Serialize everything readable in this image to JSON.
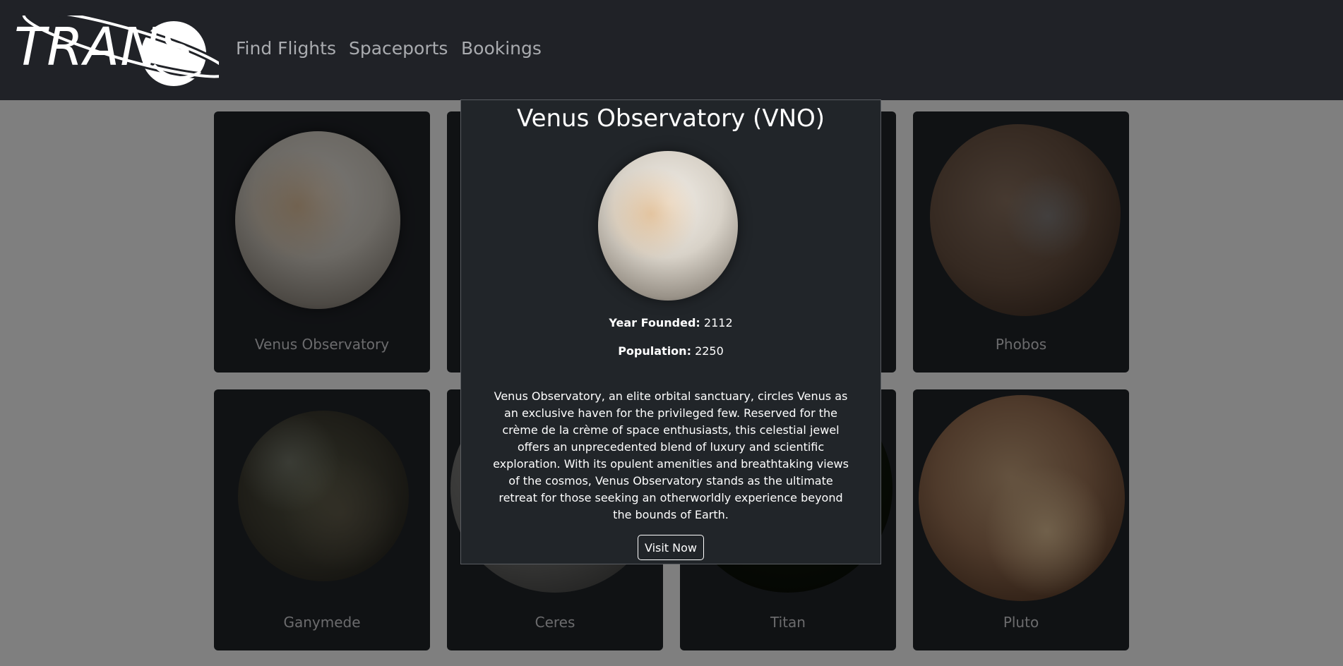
{
  "nav": {
    "logo_text": "TRANS",
    "links": [
      "Find Flights",
      "Spaceports",
      "Bookings"
    ]
  },
  "cards": [
    {
      "name": "Venus Observatory",
      "icon": "venus-planet"
    },
    {
      "name": "Phobos",
      "icon": "phobos-moon"
    },
    {
      "name": "Ganymede",
      "icon": "ganymede-moon"
    },
    {
      "name": "Ceres",
      "icon": "ceres-dwarf-planet"
    },
    {
      "name": "Titan",
      "icon": "titan-moon"
    },
    {
      "name": "Pluto",
      "icon": "pluto-dwarf-planet"
    }
  ],
  "modal": {
    "title": "Venus Observatory (VNO)",
    "year_label": "Year Founded:",
    "year_value": "2112",
    "population_label": "Population:",
    "population_value": "2250",
    "description": "Venus Observatory, an elite orbital sanctuary, circles Venus as an exclusive haven for the privileged few. Reserved for the crème de la crème of space enthusiasts, this celestial jewel offers an unprecedented blend of luxury and scientific exploration. With its opulent amenities and breathtaking views of the cosmos, Venus Observatory stands as the ultimate retreat for those seeking an otherworldly experience beyond the bounds of Earth.",
    "button_label": "Visit Now"
  },
  "colors": {
    "navbar_bg": "#202227",
    "card_bg": "#212429",
    "modal_bg": "#212529",
    "nav_link": "#a9abaf"
  }
}
